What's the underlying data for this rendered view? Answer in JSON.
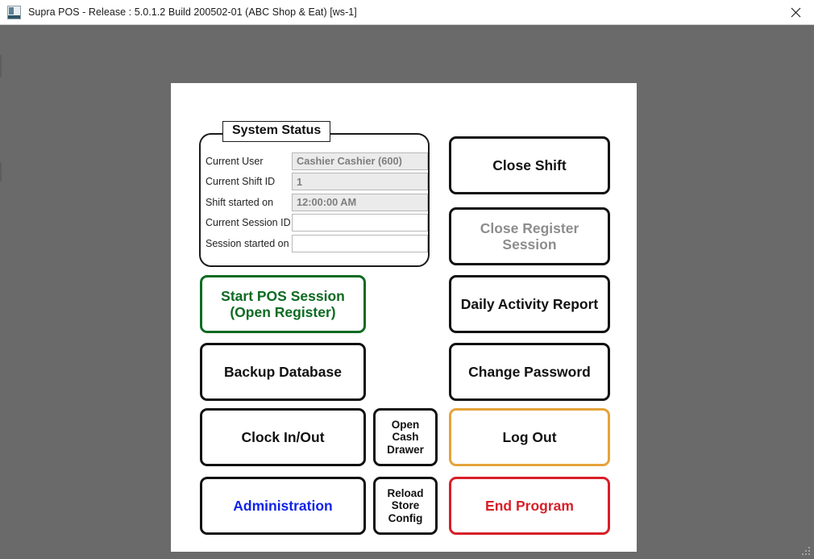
{
  "window": {
    "title": "Supra POS - Release : 5.0.1.2 Build 200502-01 (ABC Shop & Eat) [ws-1]",
    "icon": "app-icon",
    "close_label": "close-icon",
    "background_color": "#6a6a6a"
  },
  "system_status": {
    "legend": "System Status",
    "rows": [
      {
        "label": "Current User",
        "value": "Cashier Cashier (600)",
        "filled": true
      },
      {
        "label": "Current Shift ID",
        "value": "1",
        "filled": true
      },
      {
        "label": "Shift started on",
        "value": "12:00:00 AM",
        "filled": true
      },
      {
        "label": "Current Session ID",
        "value": "",
        "filled": false
      },
      {
        "label": "Session started on",
        "value": "",
        "filled": false
      }
    ]
  },
  "buttons": {
    "close_shift": "Close Shift",
    "close_register_session_line1": "Close Register",
    "close_register_session_line2": "Session",
    "daily_activity_report": "Daily Activity Report",
    "change_password": "Change Password",
    "log_out": "Log Out",
    "end_program": "End Program",
    "start_pos_session_line1": "Start POS Session",
    "start_pos_session_line2": "(Open Register)",
    "backup_database": "Backup Database",
    "clock_in_out": "Clock In/Out",
    "administration": "Administration",
    "open_cash_drawer_line1": "Open",
    "open_cash_drawer_line2": "Cash",
    "open_cash_drawer_line3": "Drawer",
    "reload_store_config_line1": "Reload",
    "reload_store_config_line2": "Store",
    "reload_store_config_line3": "Config"
  },
  "colors": {
    "start_session_accent": "#0d6b22",
    "log_out_accent": "#e5a33a",
    "end_program_accent": "#d71f28",
    "administration_accent": "#1024e8",
    "disabled_text": "#8d8d8d"
  }
}
